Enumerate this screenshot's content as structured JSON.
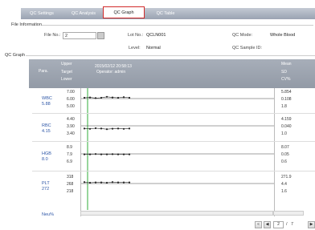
{
  "tabs": [
    {
      "label": "QC Settings"
    },
    {
      "label": "QC Analysis"
    },
    {
      "label": "QC Graph"
    },
    {
      "label": "QC Table"
    }
  ],
  "file_info": {
    "section_title": "File Information",
    "file_no_label": "File No.:",
    "file_no_value": "2",
    "lot_no_label": "Lot No.:",
    "lot_no_value": "QCLN001",
    "level_label": "Level:",
    "level_value": "Normal",
    "qc_mode_label": "QC Mode:",
    "qc_mode_value": "Whole Blood",
    "qc_sample_id_label": "QC Sample ID:",
    "qc_sample_id_value": ""
  },
  "graph": {
    "section_title": "QC Graph",
    "col_para": "Para.",
    "col_upper": "Upper",
    "col_target": "Target",
    "col_lower": "Lower",
    "date": "2015/02/12 20:58:13",
    "operator": "Operator:  admin",
    "col_mean": "Mean",
    "col_sd": "SD",
    "col_cv": "CV%",
    "params": [
      {
        "name": "WBC",
        "value": "5.88",
        "upper": "7.00",
        "target": "6.00",
        "lower": "5.00",
        "mean": "5.854",
        "sd": "0.108",
        "cv": "1.8",
        "points": [
          0.5,
          0.48,
          0.52,
          0.5,
          0.44,
          0.48,
          0.5,
          0.46,
          0.5
        ]
      },
      {
        "name": "RBC",
        "value": "4.15",
        "upper": "4.40",
        "target": "3.90",
        "lower": "3.40",
        "mean": "4.159",
        "sd": "0.040",
        "cv": "1.0",
        "points": [
          0.72,
          0.74,
          0.7,
          0.72,
          0.76,
          0.73,
          0.72,
          0.74,
          0.72
        ]
      },
      {
        "name": "HGB",
        "value": "8.0",
        "upper": "8.9",
        "target": "7.9",
        "lower": "6.9",
        "mean": "8.07",
        "sd": "0.05",
        "cv": "0.6",
        "points": [
          0.58,
          0.58,
          0.56,
          0.58,
          0.58,
          0.57,
          0.58,
          0.58,
          0.58
        ]
      },
      {
        "name": "PLT",
        "value": "272",
        "upper": "318",
        "target": "268",
        "lower": "218",
        "mean": "271.9",
        "sd": "4.4",
        "cv": "1.6",
        "points": [
          0.46,
          0.5,
          0.48,
          0.48,
          0.5,
          0.46,
          0.48,
          0.48,
          0.48
        ]
      }
    ],
    "next_param": "Neu%"
  },
  "pager": {
    "first": "«",
    "prev": "◀",
    "current": "2",
    "sep": "/",
    "total": "7",
    "next": "▶"
  },
  "colors": {
    "active_tab_border": "#d12a2a",
    "param_text": "#2c55a6",
    "marker": "#222222",
    "green_line": "#2fae3a"
  }
}
